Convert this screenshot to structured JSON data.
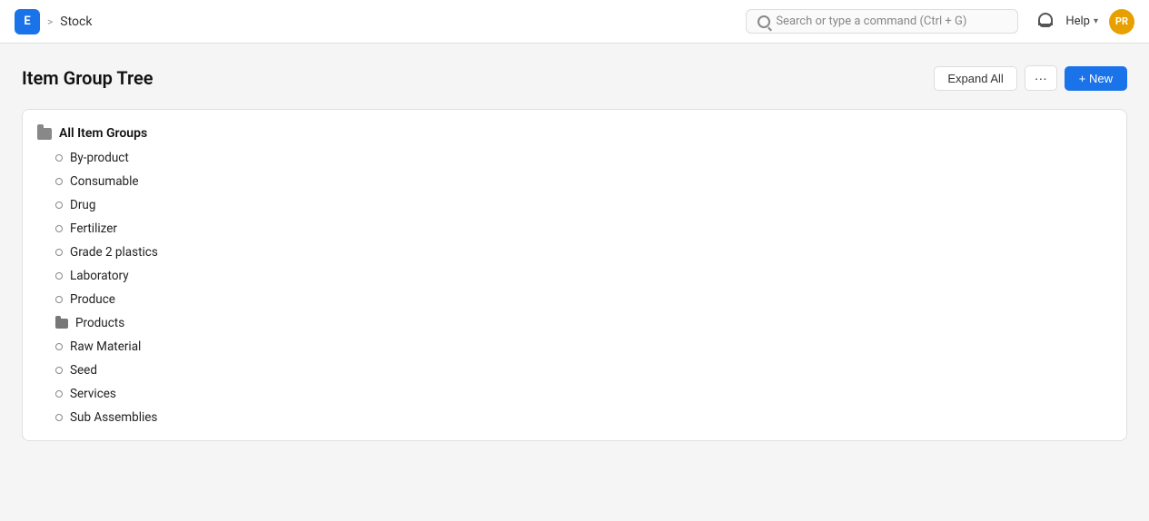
{
  "topnav": {
    "app_letter": "E",
    "breadcrumb_separator": ">",
    "breadcrumb_label": "Stock",
    "search_placeholder": "Search or type a command (Ctrl + G)",
    "help_label": "Help",
    "avatar_label": "PR"
  },
  "page": {
    "title": "Item Group Tree",
    "expand_all_label": "Expand All",
    "more_label": "···",
    "new_label": "+ New"
  },
  "tree": {
    "root_label": "All Item Groups",
    "items": [
      {
        "label": "By-product",
        "type": "leaf"
      },
      {
        "label": "Consumable",
        "type": "leaf"
      },
      {
        "label": "Drug",
        "type": "leaf"
      },
      {
        "label": "Fertilizer",
        "type": "leaf"
      },
      {
        "label": "Grade 2 plastics",
        "type": "leaf"
      },
      {
        "label": "Laboratory",
        "type": "leaf"
      },
      {
        "label": "Produce",
        "type": "leaf"
      },
      {
        "label": "Products",
        "type": "folder"
      },
      {
        "label": "Raw Material",
        "type": "leaf"
      },
      {
        "label": "Seed",
        "type": "leaf"
      },
      {
        "label": "Services",
        "type": "leaf"
      },
      {
        "label": "Sub Assemblies",
        "type": "leaf"
      }
    ]
  }
}
